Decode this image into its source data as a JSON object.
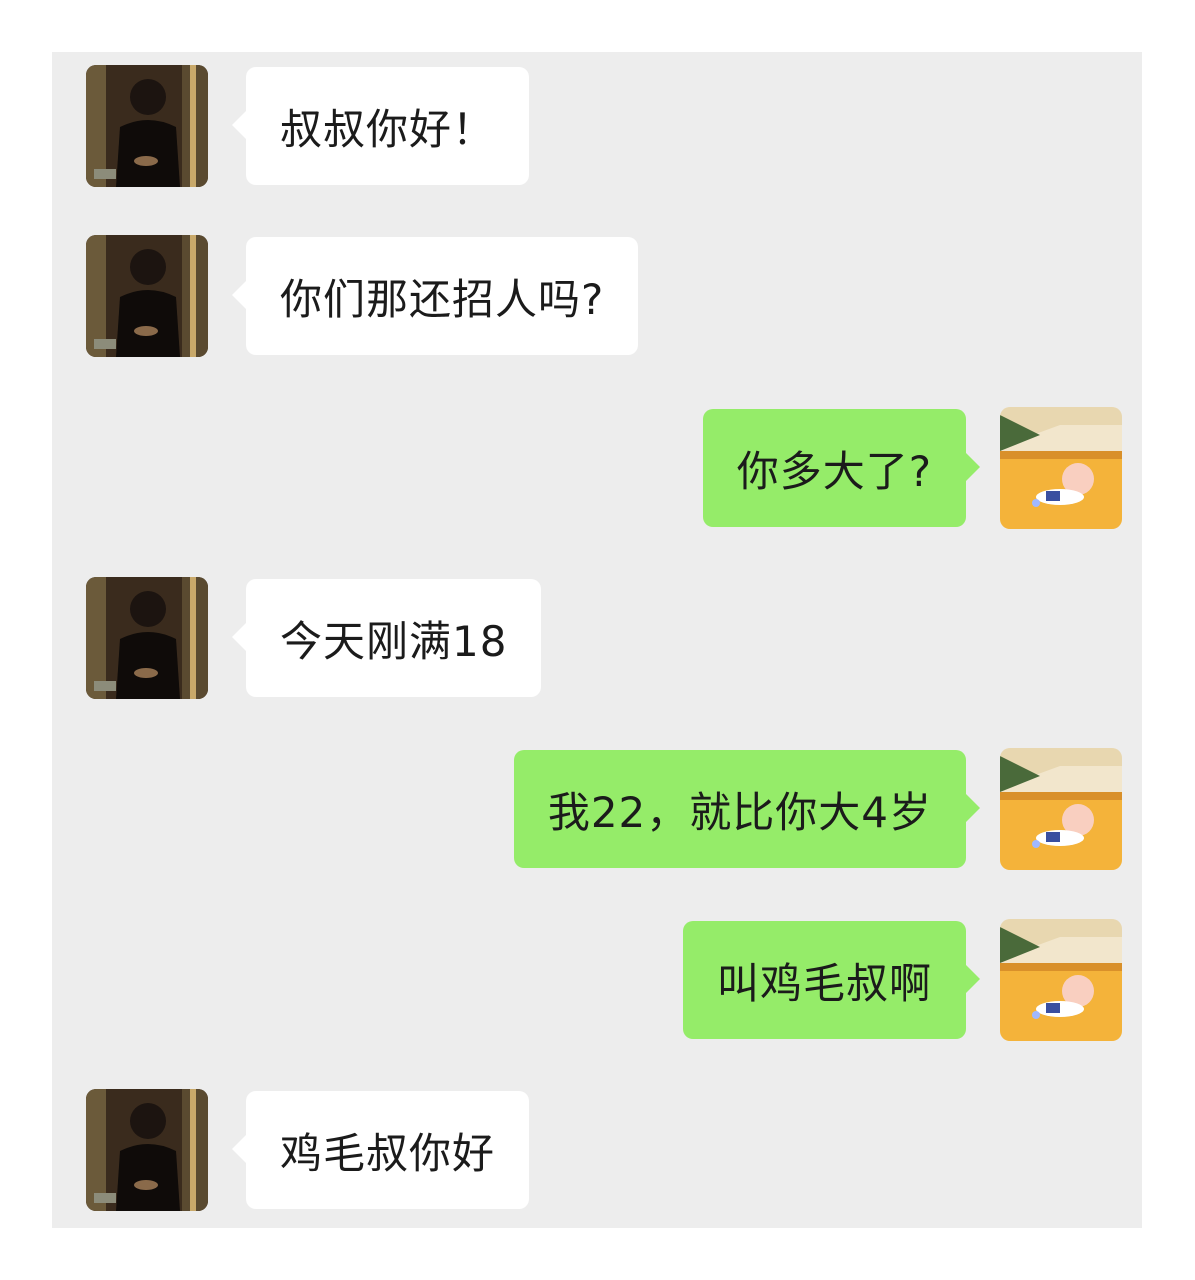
{
  "chat": {
    "messages": [
      {
        "sender": "other",
        "text": "叔叔你好！"
      },
      {
        "sender": "other",
        "text": "你们那还招人吗?"
      },
      {
        "sender": "me",
        "text": "你多大了?"
      },
      {
        "sender": "other",
        "text": "今天刚满18"
      },
      {
        "sender": "me",
        "text": "我22，就比你大4岁"
      },
      {
        "sender": "me",
        "text": "叫鸡毛叔啊"
      },
      {
        "sender": "other",
        "text": "鸡毛叔你好"
      }
    ]
  },
  "colors": {
    "sent_bubble": "#95ec69",
    "received_bubble": "#ffffff",
    "chat_background": "#ededed"
  },
  "icons": {
    "other_avatar": "person-photo-avatar-icon",
    "my_avatar": "cartoon-avatar-icon"
  }
}
